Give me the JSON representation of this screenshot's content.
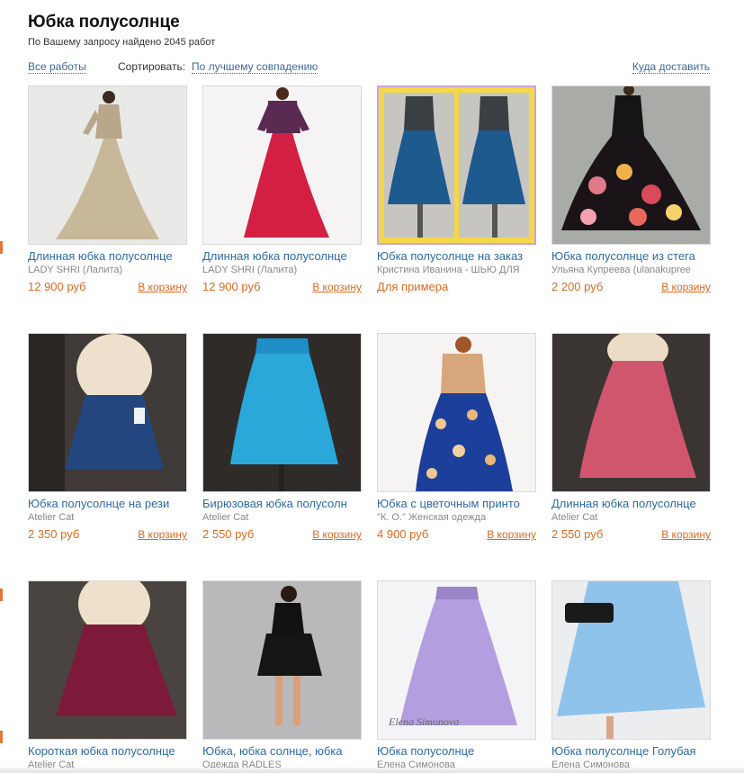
{
  "header": {
    "title": "Юбка полусолнце",
    "result_count": "По Вашему запросу найдено 2045 работ"
  },
  "filters": {
    "all_works": "Все работы",
    "sort_label": "Сортировать:",
    "sort_value": "По лучшему совпадению",
    "delivery": "Куда доставить"
  },
  "products": [
    {
      "title": "Длинная юбка полусолнце",
      "seller": "LADY SHRI (Лалита)",
      "price": "12 900 руб",
      "cart": "В корзину"
    },
    {
      "title": "Длинная юбка полусолнце",
      "seller": "LADY SHRI (Лалита)",
      "price": "12 900 руб",
      "cart": "В корзину"
    },
    {
      "title": "Юбка полусолнце на заказ",
      "seller": "Кристина Иванина - ШЬЮ ДЛЯ",
      "price": "Для примера",
      "cart": ""
    },
    {
      "title": "Юбка полусолнце из стега",
      "seller": "Ульяна Купреева (ulanakupree",
      "price": "2 200 руб",
      "cart": "В корзину"
    },
    {
      "title": "Юбка полусолнце на рези",
      "seller": "Atelier Cat",
      "price": "2 350 руб",
      "cart": "В корзину"
    },
    {
      "title": "Бирюзовая юбка полусолн",
      "seller": "Atelier Cat",
      "price": "2 550 руб",
      "cart": "В корзину"
    },
    {
      "title": "Юбка с цветочным принто",
      "seller": "\"К. О.\" Женская одежда",
      "price": "4 900 руб",
      "cart": "В корзину"
    },
    {
      "title": "Длинная юбка полусолнце",
      "seller": "Atelier Cat",
      "price": "2 550 руб",
      "cart": "В корзину"
    },
    {
      "title": "Короткая юбка полусолнце",
      "seller": "Atelier Cat",
      "price": "",
      "cart": ""
    },
    {
      "title": "Юбка, юбка солнце, юбка",
      "seller": "Одежда RADLES",
      "price": "",
      "cart": ""
    },
    {
      "title": "Юбка полусолнце",
      "seller": "Елена Симонова",
      "price": "",
      "cart": ""
    },
    {
      "title": "Юбка полусолнце Голубая",
      "seller": "Елена Симонова",
      "price": "",
      "cart": ""
    }
  ],
  "watermark": "Elena Simonova",
  "colors": {
    "link": "#2d6aa9",
    "price": "#e06a1f",
    "edge_marker": "#e5763a"
  }
}
